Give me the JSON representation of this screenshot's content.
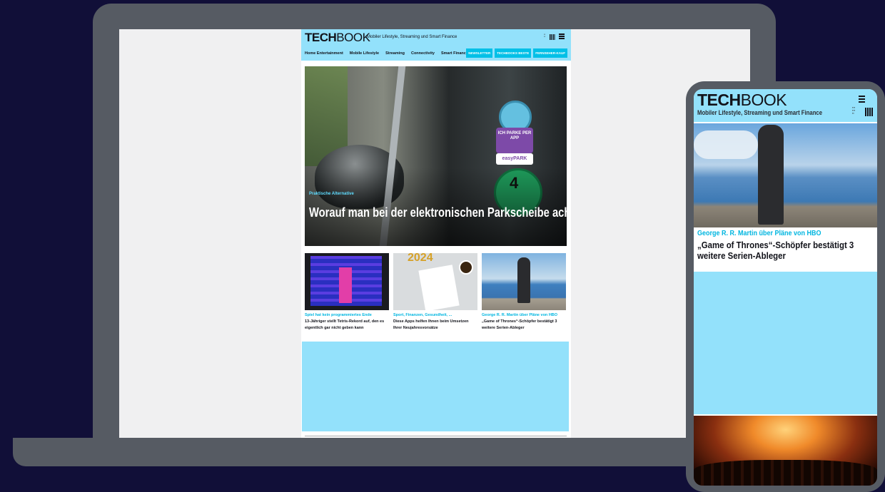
{
  "desktop": {
    "logo_bold": "TECH",
    "logo_light": "BOOK",
    "tagline": "Mobiler Lifestyle, Streaming und Smart Finance",
    "nav": [
      "Home Entertainment",
      "Mobile Lifestyle",
      "Streaming",
      "Connectivity",
      "Smart Finance"
    ],
    "buttons": [
      "NEWSLETTER",
      "TECHBOOKS BESTE",
      "FERNSEHER-KAUF"
    ],
    "hero": {
      "kicker": "Praktische Alternative",
      "title": "Worauf man bei der elektronischen Parkscheibe achten muss",
      "sticker_text": "ICH PARKE PER APP",
      "sticker_brand": "easyPARK",
      "plakette_number": "4"
    },
    "teasers": [
      {
        "kicker": "Spiel hat kein programmiertes Ende",
        "title": "13-Jähriger stellt Tetris-Rekord auf, den es eigentlich gar nicht geben kann"
      },
      {
        "kicker": "Sport, Finanzen, Gesundheit, ...",
        "title": "Diese Apps helfen Ihnen beim Umsetzen Ihrer Neujahresvorsätze",
        "image_year": "2024"
      },
      {
        "kicker": "George R. R. Martin über Pläne von HBO",
        "title": "„Game of Thrones“-Schöpfer bestätigt 3 weitere Serien-Ableger"
      }
    ]
  },
  "mobile": {
    "logo_bold": "TECH",
    "logo_light": "BOOK",
    "tagline": "Mobiler Lifestyle, Streaming und Smart Finance",
    "article": {
      "kicker": "George R. R. Martin über Pläne von HBO",
      "title": "„Game of Thrones“-Schöpfer bestätigt 3 weitere Serien-Ableger"
    }
  },
  "colors": {
    "background": "#110f38",
    "device": "#565b63",
    "header": "#93e1fb",
    "accent": "#01c0e7",
    "kicker": "#01b6e0"
  },
  "icons": [
    "menu-icon",
    "brand-mark-icon"
  ]
}
